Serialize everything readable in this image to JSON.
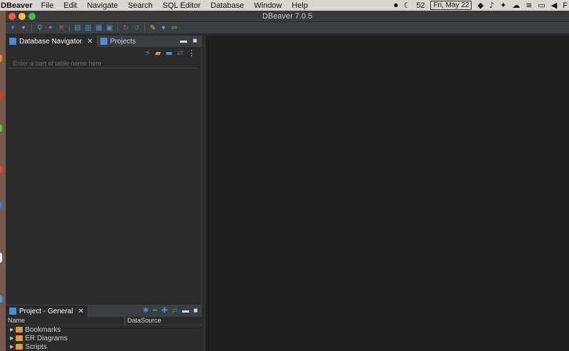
{
  "menubar": {
    "app_name": "DBeaver",
    "menus": [
      "File",
      "Edit",
      "Navigate",
      "Search",
      "SQL Editor",
      "Database",
      "Window",
      "Help"
    ],
    "temperature": "52",
    "date": "Fri, May 22",
    "extra": "F"
  },
  "window": {
    "title": "DBeaver 7.0.5"
  },
  "navigator": {
    "tab_label": "Database Navigator",
    "projects_tab_label": "Projects",
    "filter_placeholder": "Enter a part of table name here"
  },
  "project_panel": {
    "tab_label": "Project - General",
    "columns": [
      "Name",
      "DataSource"
    ],
    "items": [
      "Bookmarks",
      "ER Diagrams",
      "Scripts"
    ]
  },
  "colors": {
    "accent_blue": "#4a8fd6",
    "folder_orange": "#e09a3e",
    "close": "#fc5753",
    "minimize": "#fdbc40",
    "zoom": "#33c748"
  }
}
